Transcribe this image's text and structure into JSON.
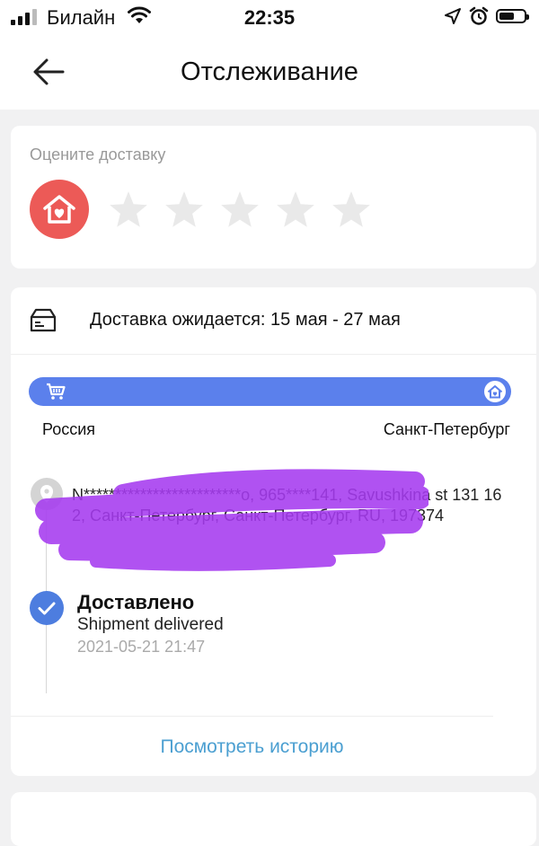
{
  "status_bar": {
    "carrier": "Билайн",
    "time": "22:35",
    "icons": [
      "signal-icon",
      "wifi-icon",
      "location-arrow-icon",
      "alarm-icon",
      "battery-icon"
    ]
  },
  "nav": {
    "title": "Отслеживание",
    "back_icon": "arrow-left-icon"
  },
  "rating": {
    "label": "Оцените доставку",
    "stars_total": 5,
    "stars_selected": 0,
    "badge_icon": "house-heart-icon"
  },
  "delivery": {
    "eta": "Доставка ожидается: 15 мая - 27 мая",
    "from": "Россия",
    "to": "Санкт-Петербург",
    "progress": 1.0,
    "address": "N*************************o,  965****141,  Savushkina st 131 162,  Санкт-Петербург,  Санкт-Петербург,  RU,  197374",
    "status_title": "Доставлено",
    "status_subtitle": "Shipment delivered",
    "status_datetime": "2021-05-21 21:47",
    "history_link": "Посмотреть историю"
  },
  "colors": {
    "accent_blue": "#5b80ec",
    "badge_red": "#ec5a57",
    "link_blue": "#4b9fd1",
    "scribble_purple": "#a63bf0"
  }
}
